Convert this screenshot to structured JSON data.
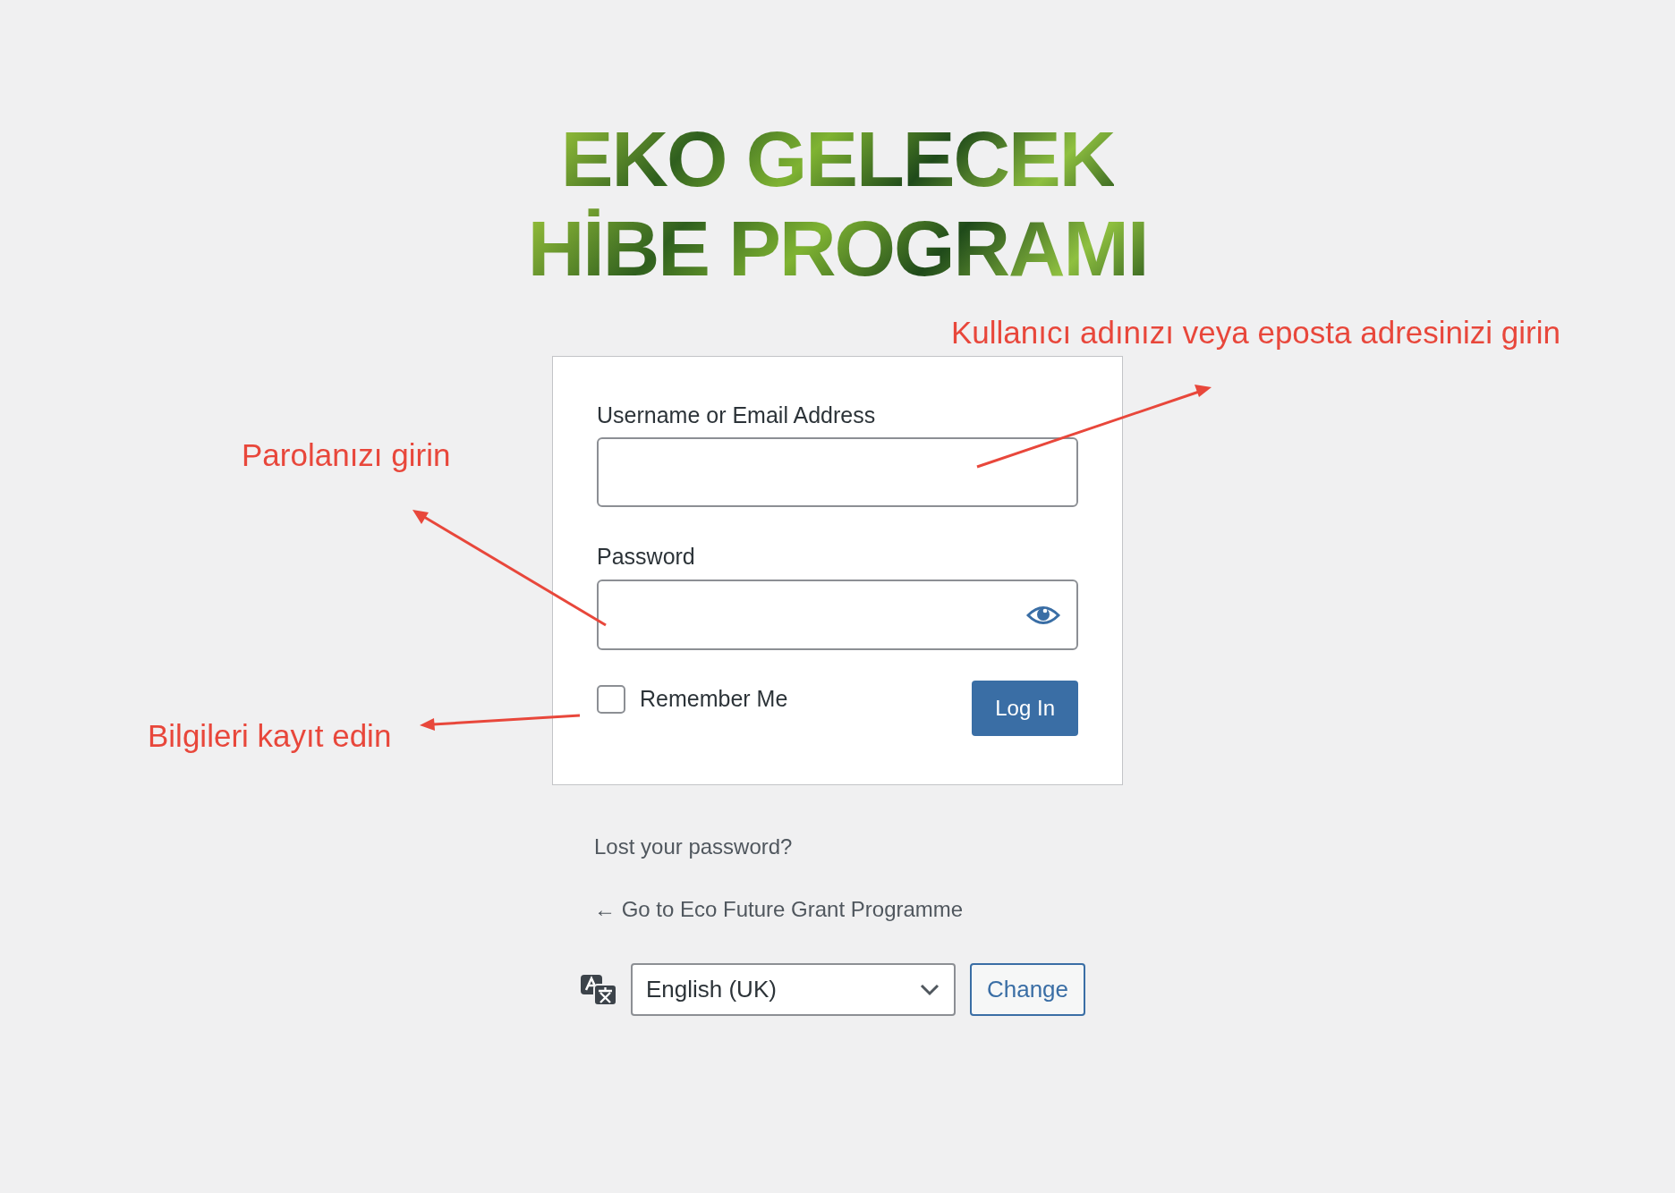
{
  "logo": {
    "lines": [
      "EKO GELECEK",
      "HİBE PROGRAMI"
    ]
  },
  "login_form": {
    "username": {
      "label": "Username or Email Address"
    },
    "password": {
      "label": "Password"
    },
    "remember_me": {
      "label": "Remember Me",
      "checked": false
    },
    "submit": "Log In"
  },
  "links": [
    "Lost your password?",
    "← Go to Eco Future Grant Programme"
  ],
  "language": {
    "value": "English (UK)",
    "button": "Change"
  },
  "annotations": [
    {
      "text": "Kullanıcı adınızı veya eposta adresinizi girin"
    },
    {
      "text": "Parolanızı girin"
    },
    {
      "text": "Bilgileri kayıt edin"
    }
  ]
}
